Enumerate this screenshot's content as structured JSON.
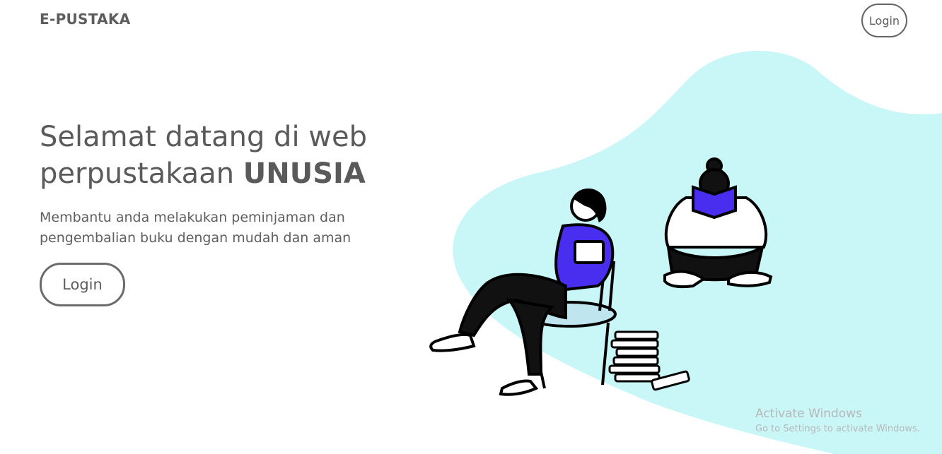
{
  "navbar": {
    "brand": "E-PUSTAKA",
    "login_label": "Login"
  },
  "hero": {
    "title_line1": "Selamat datang di web",
    "title_line2_prefix": "perpustakaan ",
    "title_line2_strong": "UNUSIA",
    "subtitle": "Membantu anda melakukan peminjaman dan pengembalian buku dengan mudah dan aman",
    "login_label": "Login"
  },
  "watermark": {
    "title": "Activate Windows",
    "subtitle": "Go to Settings to activate Windows."
  },
  "colors": {
    "blob": "#c9f7f8",
    "text": "#5f5f5f",
    "book_blue": "#4a2ef0"
  }
}
